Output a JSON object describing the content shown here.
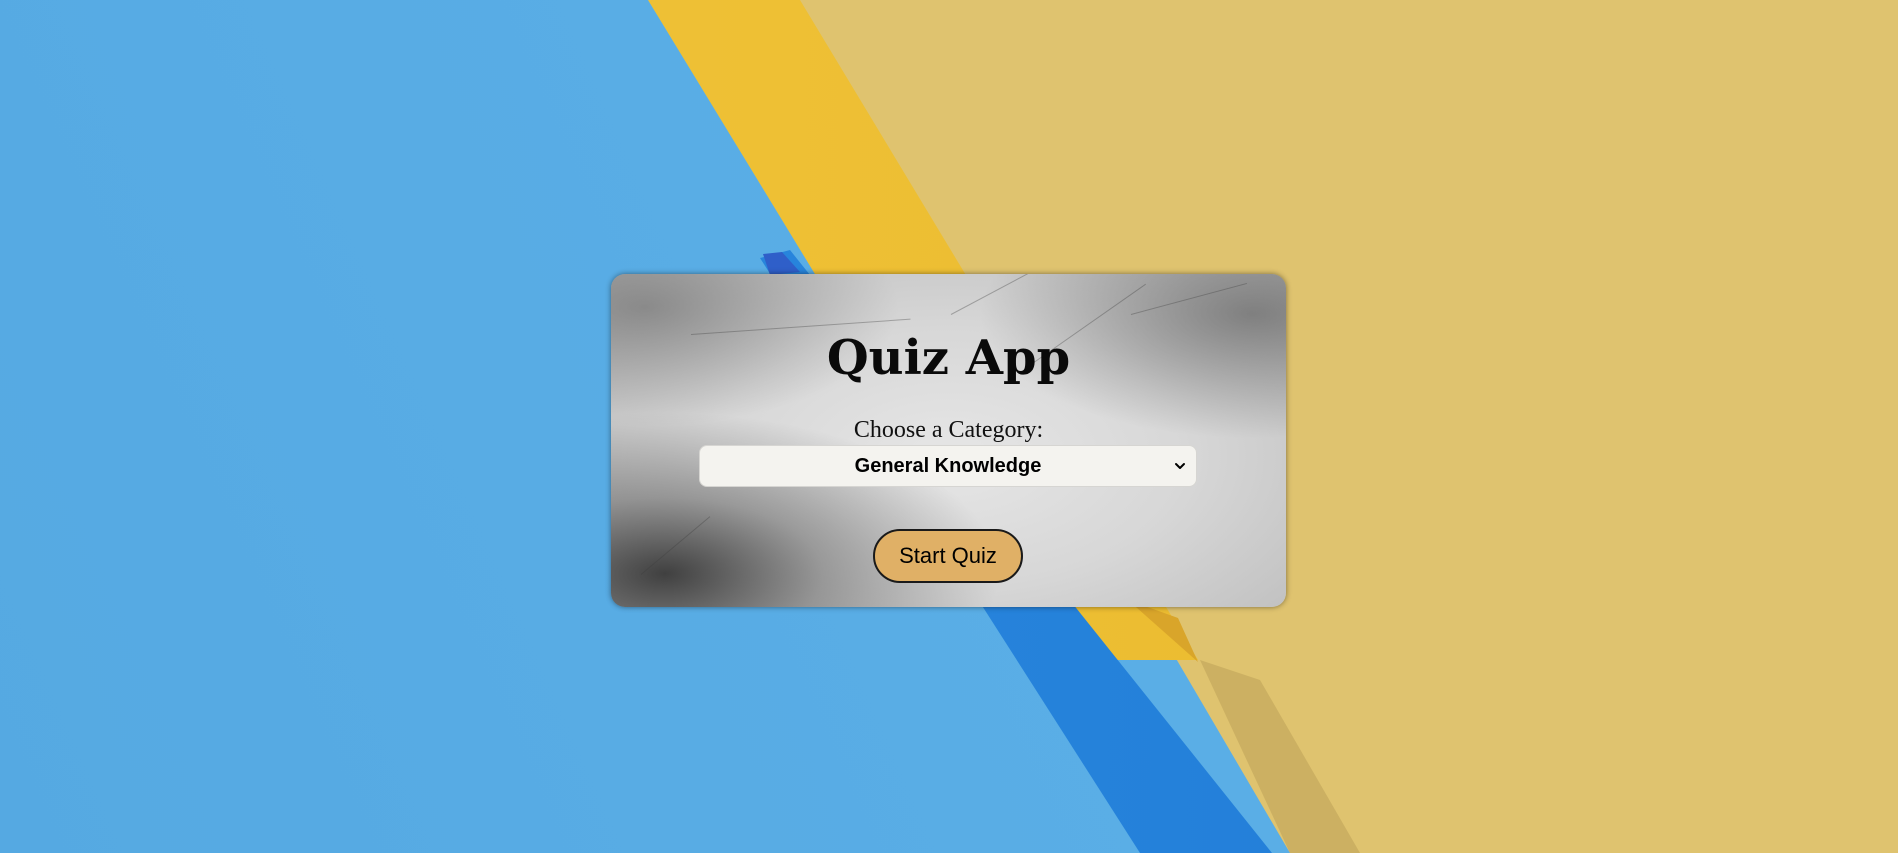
{
  "quiz": {
    "title": "Quiz App",
    "category_label": "Choose a Category:",
    "category_select": {
      "selected": "General Knowledge"
    },
    "start_button_label": "Start Quiz"
  },
  "colors": {
    "background_blue": "#57abe3",
    "background_yellow": "#dfc36f",
    "button_fill": "#e0b066",
    "select_fill": "#f4f3ef"
  },
  "icons": {
    "select_arrow": "chevron-down-icon"
  }
}
